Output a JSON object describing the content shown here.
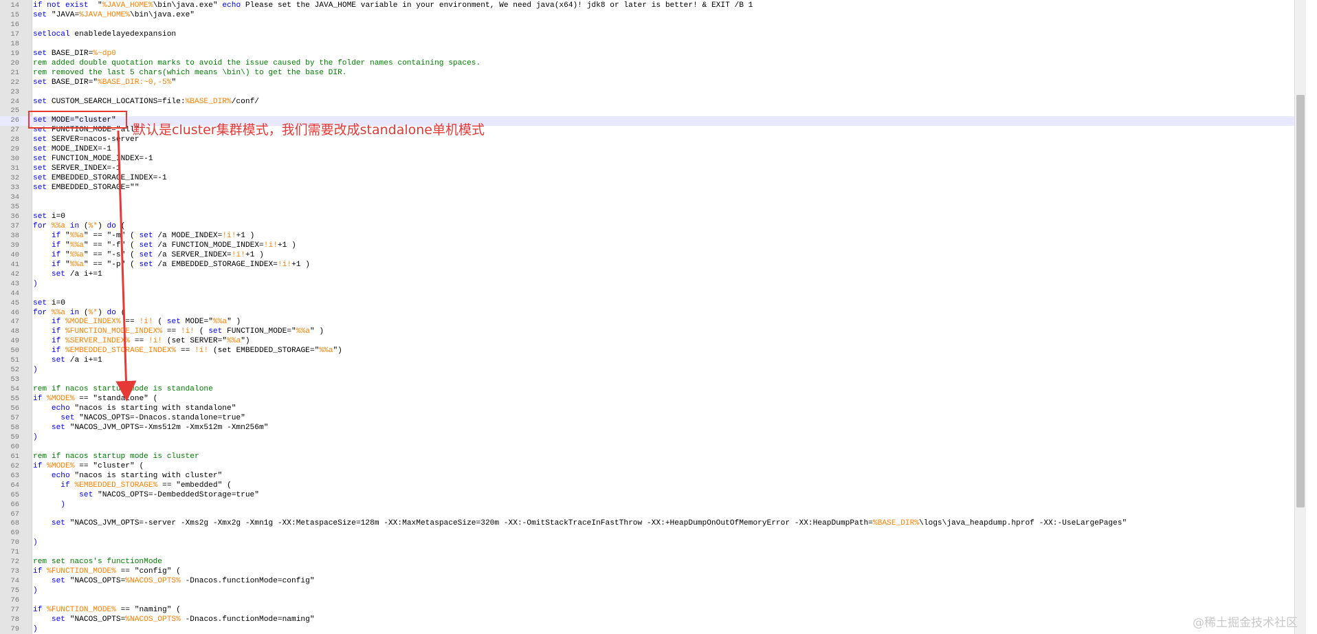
{
  "editor": {
    "lines": [
      {
        "n": "14",
        "segs": [
          [
            "kw",
            "if not exist"
          ],
          [
            "",
            "  \""
          ],
          [
            "var",
            "%JAVA_HOME%"
          ],
          [
            "",
            "\\bin\\java.exe\" "
          ],
          [
            "kw",
            "echo"
          ],
          [
            "",
            " Please set the JAVA_HOME variable in your environment, We need java(x64)! jdk8 or later is better! & EXIT /B 1"
          ]
        ]
      },
      {
        "n": "15",
        "segs": [
          [
            "kw",
            "set"
          ],
          [
            "",
            " \"JAVA="
          ],
          [
            "var",
            "%JAVA_HOME%"
          ],
          [
            "",
            "\\bin\\java.exe\""
          ]
        ]
      },
      {
        "n": "16",
        "segs": []
      },
      {
        "n": "17",
        "segs": [
          [
            "kw",
            "setlocal"
          ],
          [
            "",
            " enabledelayedexpansion"
          ]
        ]
      },
      {
        "n": "18",
        "segs": []
      },
      {
        "n": "19",
        "segs": [
          [
            "kw",
            "set"
          ],
          [
            "",
            " BASE_DIR="
          ],
          [
            "var",
            "%~dp0"
          ]
        ]
      },
      {
        "n": "20",
        "segs": [
          [
            "cm",
            "rem added double quotation marks to avoid the issue caused by the folder names containing spaces."
          ]
        ]
      },
      {
        "n": "21",
        "segs": [
          [
            "cm",
            "rem removed the last 5 chars(which means \\bin\\) to get the base DIR."
          ]
        ]
      },
      {
        "n": "22",
        "segs": [
          [
            "kw",
            "set"
          ],
          [
            "",
            " BASE_DIR=\""
          ],
          [
            "var",
            "%BASE_DIR:~0,-5%"
          ],
          [
            "",
            "\""
          ]
        ]
      },
      {
        "n": "23",
        "segs": []
      },
      {
        "n": "24",
        "segs": [
          [
            "kw",
            "set"
          ],
          [
            "",
            " CUSTOM_SEARCH_LOCATIONS=file:"
          ],
          [
            "var",
            "%BASE_DIR%"
          ],
          [
            "",
            "/conf/"
          ]
        ]
      },
      {
        "n": "25",
        "segs": []
      },
      {
        "n": "26",
        "segs": [
          [
            "kw",
            "set"
          ],
          [
            "",
            " MODE=\"cluster\""
          ]
        ]
      },
      {
        "n": "27",
        "segs": [
          [
            "kw",
            "set"
          ],
          [
            "",
            " FUNCTION_MODE=\"all\""
          ]
        ]
      },
      {
        "n": "28",
        "segs": [
          [
            "kw",
            "set"
          ],
          [
            "",
            " SERVER=nacos-server"
          ]
        ]
      },
      {
        "n": "29",
        "segs": [
          [
            "kw",
            "set"
          ],
          [
            "",
            " MODE_INDEX=-1"
          ]
        ]
      },
      {
        "n": "30",
        "segs": [
          [
            "kw",
            "set"
          ],
          [
            "",
            " FUNCTION_MODE_INDEX=-1"
          ]
        ]
      },
      {
        "n": "31",
        "segs": [
          [
            "kw",
            "set"
          ],
          [
            "",
            " SERVER_INDEX=-1"
          ]
        ]
      },
      {
        "n": "32",
        "segs": [
          [
            "kw",
            "set"
          ],
          [
            "",
            " EMBEDDED_STORAGE_INDEX=-1"
          ]
        ]
      },
      {
        "n": "33",
        "segs": [
          [
            "kw",
            "set"
          ],
          [
            "",
            " EMBEDDED_STORAGE=\"\""
          ]
        ]
      },
      {
        "n": "34",
        "segs": []
      },
      {
        "n": "35",
        "segs": []
      },
      {
        "n": "36",
        "segs": [
          [
            "kw",
            "set"
          ],
          [
            "",
            " i=0"
          ]
        ]
      },
      {
        "n": "37",
        "segs": [
          [
            "kw",
            "for"
          ],
          [
            "",
            " "
          ],
          [
            "var",
            "%%a"
          ],
          [
            "",
            " "
          ],
          [
            "kw",
            "in"
          ],
          [
            "",
            " ("
          ],
          [
            "var",
            "%*"
          ],
          [
            "",
            ") "
          ],
          [
            "kw",
            "do"
          ],
          [
            "",
            " ("
          ]
        ]
      },
      {
        "n": "38",
        "segs": [
          [
            "",
            "    "
          ],
          [
            "kw",
            "if"
          ],
          [
            "",
            " \""
          ],
          [
            "var",
            "%%a"
          ],
          [
            "",
            "\" == \"-m\" ( "
          ],
          [
            "kw",
            "set"
          ],
          [
            "",
            " /a MODE_INDEX="
          ],
          [
            "var",
            "!i!"
          ],
          [
            "",
            "+1 )"
          ]
        ]
      },
      {
        "n": "39",
        "segs": [
          [
            "",
            "    "
          ],
          [
            "kw",
            "if"
          ],
          [
            "",
            " \""
          ],
          [
            "var",
            "%%a"
          ],
          [
            "",
            "\" == \"-f\" ( "
          ],
          [
            "kw",
            "set"
          ],
          [
            "",
            " /a FUNCTION_MODE_INDEX="
          ],
          [
            "var",
            "!i!"
          ],
          [
            "",
            "+1 )"
          ]
        ]
      },
      {
        "n": "40",
        "segs": [
          [
            "",
            "    "
          ],
          [
            "kw",
            "if"
          ],
          [
            "",
            " \""
          ],
          [
            "var",
            "%%a"
          ],
          [
            "",
            "\" == \"-s\" ( "
          ],
          [
            "kw",
            "set"
          ],
          [
            "",
            " /a SERVER_INDEX="
          ],
          [
            "var",
            "!i!"
          ],
          [
            "",
            "+1 )"
          ]
        ]
      },
      {
        "n": "41",
        "segs": [
          [
            "",
            "    "
          ],
          [
            "kw",
            "if"
          ],
          [
            "",
            " \""
          ],
          [
            "var",
            "%%a"
          ],
          [
            "",
            "\" == \"-p\" ( "
          ],
          [
            "kw",
            "set"
          ],
          [
            "",
            " /a EMBEDDED_STORAGE_INDEX="
          ],
          [
            "var",
            "!i!"
          ],
          [
            "",
            "+1 )"
          ]
        ]
      },
      {
        "n": "42",
        "segs": [
          [
            "",
            "    "
          ],
          [
            "kw",
            "set"
          ],
          [
            "",
            " /a i+=1"
          ]
        ]
      },
      {
        "n": "43",
        "segs": [
          [
            "kw",
            ")"
          ]
        ]
      },
      {
        "n": "44",
        "segs": []
      },
      {
        "n": "45",
        "segs": [
          [
            "kw",
            "set"
          ],
          [
            "",
            " i=0"
          ]
        ]
      },
      {
        "n": "46",
        "segs": [
          [
            "kw",
            "for"
          ],
          [
            "",
            " "
          ],
          [
            "var",
            "%%a"
          ],
          [
            "",
            " "
          ],
          [
            "kw",
            "in"
          ],
          [
            "",
            " ("
          ],
          [
            "var",
            "%*"
          ],
          [
            "",
            ") "
          ],
          [
            "kw",
            "do"
          ],
          [
            "",
            " ("
          ]
        ]
      },
      {
        "n": "47",
        "segs": [
          [
            "",
            "    "
          ],
          [
            "kw",
            "if"
          ],
          [
            "",
            " "
          ],
          [
            "var",
            "%MODE_INDEX%"
          ],
          [
            "",
            " == "
          ],
          [
            "var",
            "!i!"
          ],
          [
            "",
            " ( "
          ],
          [
            "kw",
            "set"
          ],
          [
            "",
            " MODE=\""
          ],
          [
            "var",
            "%%a"
          ],
          [
            "",
            "\" )"
          ]
        ]
      },
      {
        "n": "48",
        "segs": [
          [
            "",
            "    "
          ],
          [
            "kw",
            "if"
          ],
          [
            "",
            " "
          ],
          [
            "var",
            "%FUNCTION_MODE_INDEX%"
          ],
          [
            "",
            " == "
          ],
          [
            "var",
            "!i!"
          ],
          [
            "",
            " ( "
          ],
          [
            "kw",
            "set"
          ],
          [
            "",
            " FUNCTION_MODE=\""
          ],
          [
            "var",
            "%%a"
          ],
          [
            "",
            "\" )"
          ]
        ]
      },
      {
        "n": "49",
        "segs": [
          [
            "",
            "    "
          ],
          [
            "kw",
            "if"
          ],
          [
            "",
            " "
          ],
          [
            "var",
            "%SERVER_INDEX%"
          ],
          [
            "",
            " == "
          ],
          [
            "var",
            "!i!"
          ],
          [
            "",
            " (set SERVER=\""
          ],
          [
            "var",
            "%%a"
          ],
          [
            "",
            "\")"
          ]
        ]
      },
      {
        "n": "50",
        "segs": [
          [
            "",
            "    "
          ],
          [
            "kw",
            "if"
          ],
          [
            "",
            " "
          ],
          [
            "var",
            "%EMBEDDED_STORAGE_INDEX%"
          ],
          [
            "",
            " == "
          ],
          [
            "var",
            "!i!"
          ],
          [
            "",
            " (set EMBEDDED_STORAGE=\""
          ],
          [
            "var",
            "%%a"
          ],
          [
            "",
            "\")"
          ]
        ]
      },
      {
        "n": "51",
        "segs": [
          [
            "",
            "    "
          ],
          [
            "kw",
            "set"
          ],
          [
            "",
            " /a i+=1"
          ]
        ]
      },
      {
        "n": "52",
        "segs": [
          [
            "kw",
            ")"
          ]
        ]
      },
      {
        "n": "53",
        "segs": []
      },
      {
        "n": "54",
        "segs": [
          [
            "cm",
            "rem if nacos startup mode is standalone"
          ]
        ]
      },
      {
        "n": "55",
        "segs": [
          [
            "kw",
            "if"
          ],
          [
            "",
            " "
          ],
          [
            "var",
            "%MODE%"
          ],
          [
            "",
            " == \"standalone\" ("
          ]
        ]
      },
      {
        "n": "56",
        "segs": [
          [
            "",
            "    "
          ],
          [
            "kw",
            "echo"
          ],
          [
            "",
            " \"nacos is starting with standalone\""
          ]
        ]
      },
      {
        "n": "57",
        "segs": [
          [
            "",
            "      "
          ],
          [
            "kw",
            "set"
          ],
          [
            "",
            " \"NACOS_OPTS=-Dnacos.standalone=true\""
          ]
        ]
      },
      {
        "n": "58",
        "segs": [
          [
            "",
            "    "
          ],
          [
            "kw",
            "set"
          ],
          [
            "",
            " \"NACOS_JVM_OPTS=-Xms512m -Xmx512m -Xmn256m\""
          ]
        ]
      },
      {
        "n": "59",
        "segs": [
          [
            "kw",
            ")"
          ]
        ]
      },
      {
        "n": "60",
        "segs": []
      },
      {
        "n": "61",
        "segs": [
          [
            "cm",
            "rem if nacos startup mode is cluster"
          ]
        ]
      },
      {
        "n": "62",
        "segs": [
          [
            "kw",
            "if"
          ],
          [
            "",
            " "
          ],
          [
            "var",
            "%MODE%"
          ],
          [
            "",
            " == \"cluster\" ("
          ]
        ]
      },
      {
        "n": "63",
        "segs": [
          [
            "",
            "    "
          ],
          [
            "kw",
            "echo"
          ],
          [
            "",
            " \"nacos is starting with cluster\""
          ]
        ]
      },
      {
        "n": "64",
        "segs": [
          [
            "",
            "      "
          ],
          [
            "kw",
            "if"
          ],
          [
            "",
            " "
          ],
          [
            "var",
            "%EMBEDDED_STORAGE%"
          ],
          [
            "",
            " == \"embedded\" ("
          ]
        ]
      },
      {
        "n": "65",
        "segs": [
          [
            "",
            "          "
          ],
          [
            "kw",
            "set"
          ],
          [
            "",
            " \"NACOS_OPTS=-DembeddedStorage=true\""
          ]
        ]
      },
      {
        "n": "66",
        "segs": [
          [
            "",
            "      "
          ],
          [
            "kw",
            ")"
          ]
        ]
      },
      {
        "n": "67",
        "segs": []
      },
      {
        "n": "68",
        "segs": [
          [
            "",
            "    "
          ],
          [
            "kw",
            "set"
          ],
          [
            "",
            " \"NACOS_JVM_OPTS=-server -Xms2g -Xmx2g -Xmn1g -XX:MetaspaceSize=128m -XX:MaxMetaspaceSize=320m -XX:-OmitStackTraceInFastThrow -XX:+HeapDumpOnOutOfMemoryError -XX:HeapDumpPath="
          ],
          [
            "var",
            "%BASE_DIR%"
          ],
          [
            "",
            "\\logs\\java_heapdump.hprof -XX:-UseLargePages\""
          ]
        ]
      },
      {
        "n": "69",
        "segs": []
      },
      {
        "n": "70",
        "segs": [
          [
            "kw",
            ")"
          ]
        ]
      },
      {
        "n": "71",
        "segs": []
      },
      {
        "n": "72",
        "segs": [
          [
            "cm",
            "rem set nacos's functionMode"
          ]
        ]
      },
      {
        "n": "73",
        "segs": [
          [
            "kw",
            "if"
          ],
          [
            "",
            " "
          ],
          [
            "var",
            "%FUNCTION_MODE%"
          ],
          [
            "",
            " == \"config\" ("
          ]
        ]
      },
      {
        "n": "74",
        "segs": [
          [
            "",
            "    "
          ],
          [
            "kw",
            "set"
          ],
          [
            "",
            " \"NACOS_OPTS="
          ],
          [
            "var",
            "%NACOS_OPTS%"
          ],
          [
            "",
            " -Dnacos.functionMode=config\""
          ]
        ]
      },
      {
        "n": "75",
        "segs": [
          [
            "kw",
            ")"
          ]
        ]
      },
      {
        "n": "76",
        "segs": []
      },
      {
        "n": "77",
        "segs": [
          [
            "kw",
            "if"
          ],
          [
            "",
            " "
          ],
          [
            "var",
            "%FUNCTION_MODE%"
          ],
          [
            "",
            " == \"naming\" ("
          ]
        ]
      },
      {
        "n": "78",
        "segs": [
          [
            "",
            "    "
          ],
          [
            "kw",
            "set"
          ],
          [
            "",
            " \"NACOS_OPTS="
          ],
          [
            "var",
            "%NACOS_OPTS%"
          ],
          [
            "",
            " -Dnacos.functionMode=naming\""
          ]
        ]
      },
      {
        "n": "79",
        "segs": [
          [
            "kw",
            ")"
          ]
        ]
      }
    ],
    "highlighted_line": "26"
  },
  "annotation": {
    "text": "默认是cluster集群模式，我们需要改成standalone单机模式",
    "color": "#e53935"
  },
  "watermark": "@稀土掘金技术社区"
}
